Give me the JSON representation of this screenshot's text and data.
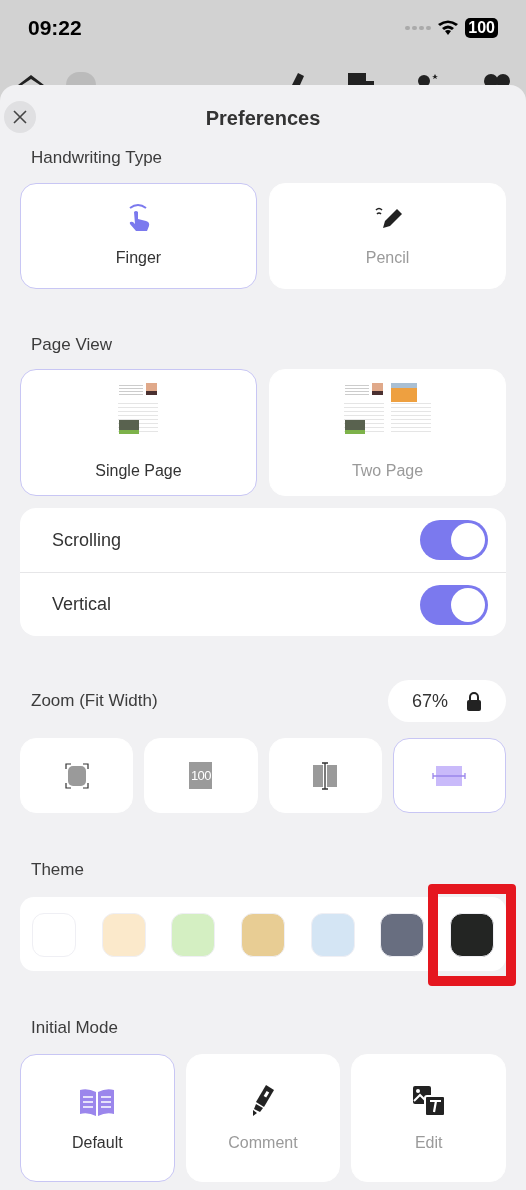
{
  "status_bar": {
    "time": "09:22",
    "battery": "100"
  },
  "sheet": {
    "title": "Preferences"
  },
  "handwriting": {
    "label": "Handwriting Type",
    "options": [
      {
        "kind": "finger",
        "label": "Finger",
        "selected": true
      },
      {
        "kind": "pencil",
        "label": "Pencil",
        "selected": false
      }
    ]
  },
  "page_view": {
    "label": "Page View",
    "options": [
      {
        "kind": "single",
        "label": "Single Page",
        "selected": true
      },
      {
        "kind": "two",
        "label": "Two Page",
        "selected": false
      }
    ],
    "toggles": [
      {
        "label": "Scrolling",
        "on": true
      },
      {
        "label": "Vertical",
        "on": true
      }
    ]
  },
  "zoom": {
    "label": "Zoom (Fit Width)",
    "value": "67%",
    "locked": true,
    "modes": [
      {
        "kind": "fit-page",
        "selected": false
      },
      {
        "kind": "actual",
        "label": "100",
        "selected": false
      },
      {
        "kind": "fit-height",
        "selected": false
      },
      {
        "kind": "fit-width",
        "selected": true
      }
    ]
  },
  "theme": {
    "label": "Theme",
    "swatches": [
      {
        "color": "#ffffff",
        "outlined": false
      },
      {
        "color": "#fbe9cb",
        "outlined": false
      },
      {
        "color": "#d4efc2",
        "outlined": false
      },
      {
        "color": "#e8cd94",
        "outlined": false
      },
      {
        "color": "#d4e5f4",
        "outlined": false
      },
      {
        "color": "#686e80",
        "outlined": false
      },
      {
        "color": "#232523",
        "outlined": true
      }
    ]
  },
  "initial_mode": {
    "label": "Initial Mode",
    "options": [
      {
        "kind": "default",
        "label": "Default",
        "selected": true
      },
      {
        "kind": "comment",
        "label": "Comment",
        "selected": false
      },
      {
        "kind": "edit",
        "label": "Edit",
        "selected": false
      }
    ]
  }
}
